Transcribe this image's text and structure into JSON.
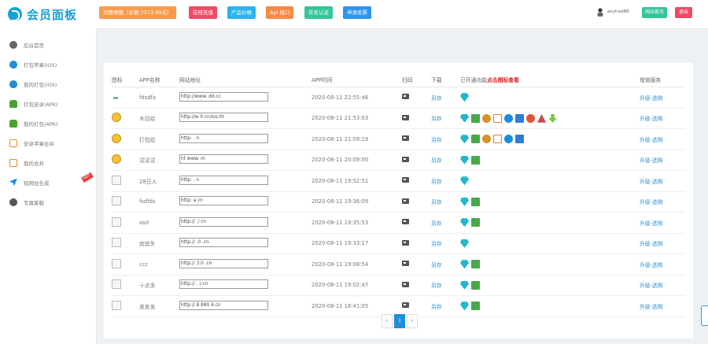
{
  "app": {
    "title": "会员面板"
  },
  "sidebar": {
    "items": [
      {
        "label": "后台首页",
        "icon": "dashboard-icon"
      },
      {
        "label": "打包苹果(IOS)",
        "icon": "apple-icon"
      },
      {
        "label": "我的打包(IOS)",
        "icon": "apple-icon"
      },
      {
        "label": "打包安卓(APK)",
        "icon": "android-icon"
      },
      {
        "label": "我的打包(APK)",
        "icon": "android-icon"
      },
      {
        "label": "安卓苹果合并",
        "icon": "merge-icon"
      },
      {
        "label": "我的合并",
        "icon": "merge-icon"
      },
      {
        "label": "短网址生成",
        "icon": "plane-icon",
        "badge": "HOT"
      },
      {
        "label": "专属客服",
        "icon": "help-icon"
      }
    ]
  },
  "topbar": {
    "buttons": [
      "消费明细（余额:7573.99元）",
      "在线充值",
      "产品价格",
      "Api 接口",
      "实名认证",
      "申请发票"
    ],
    "user_name": "aoyhad88",
    "home_label": "网站首页",
    "logout_label": "退出"
  },
  "table": {
    "headers": {
      "icon": "图标",
      "name": "APP名称",
      "url": "网站地址",
      "time": "APP时间",
      "qr": "扫码",
      "download": "下载",
      "features_prefix": "已开通功能",
      "features_highlight": "点击图标查看",
      "service": "增值服务"
    },
    "rows": [
      {
        "icon": "tiny",
        "name": "fdsdfa",
        "url": "http://www.  dd.cc",
        "time": "2020-08-11 22:55:46",
        "download": "另存",
        "service": "升级-选购",
        "features": [
          "diamond"
        ]
      },
      {
        "icon": "emoji",
        "name": "木目给",
        "url": "http://w  0 cn/ios.ht",
        "time": "2020-08-11 21:53:03",
        "download": "另存",
        "service": "升级-选购",
        "features": [
          "diamond",
          "check",
          "ball",
          "pencil",
          "ie",
          "sq",
          "fox",
          "robot",
          "down"
        ]
      },
      {
        "icon": "emoji",
        "name": "打包给",
        "url": "http:  .  n",
        "time": "2020-08-11 21:09:19",
        "download": "另存",
        "service": "升级-选购",
        "features": [
          "diamond",
          "check",
          "ball",
          "pencil",
          "ie",
          "sq"
        ]
      },
      {
        "icon": "emoji",
        "name": "试试试",
        "url": "ht  www.  m",
        "time": "2020-08-11 20:09:00",
        "download": "另存",
        "service": "升级-选购",
        "features": [
          "diamond",
          "check"
        ]
      },
      {
        "icon": "broken",
        "name": "28日人",
        "url": "http:  .  n",
        "time": "2020-08-11 19:52:51",
        "download": "另存",
        "service": "升级-选购",
        "features": [
          "diamond"
        ]
      },
      {
        "icon": "broken",
        "name": "fsdfds",
        "url": "http:  a  cn",
        "time": "2020-08-11 19:36:09",
        "download": "另存",
        "service": "升级-选购",
        "features": [
          "diamond",
          "check"
        ]
      },
      {
        "icon": "broken",
        "name": "asd",
        "url": "http://  ./  cn",
        "time": "2020-08-11 19:35:53",
        "download": "另存",
        "service": "升级-选购",
        "features": [
          "diamond",
          "check"
        ]
      },
      {
        "icon": "broken",
        "name": "宾宾失",
        "url": "http://  .0  .cn",
        "time": "2020-08-11 19:33:17",
        "download": "另存",
        "service": "升级-选购",
        "features": [
          "diamond"
        ]
      },
      {
        "icon": "broken",
        "name": "ccc",
        "url": "http://  3.0  .cn",
        "time": "2020-08-11 19:08:54",
        "download": "另存",
        "service": "升级-选购",
        "features": [
          "diamond",
          "check"
        ]
      },
      {
        "icon": "broken",
        "name": "十点多",
        "url": "http://  .  ).cn",
        "time": "2020-08-11 19:02:47",
        "download": "另存",
        "service": "升级-选购",
        "features": [
          "diamond",
          "check"
        ]
      },
      {
        "icon": "broken",
        "name": "发发发",
        "url": "http://  8.880  4.cn",
        "time": "2020-08-11 18:41:05",
        "download": "另存",
        "service": "升级-选购",
        "features": [
          "diamond",
          "check"
        ]
      }
    ]
  },
  "pagination": {
    "prev": "«",
    "current": "1",
    "next": "»"
  }
}
